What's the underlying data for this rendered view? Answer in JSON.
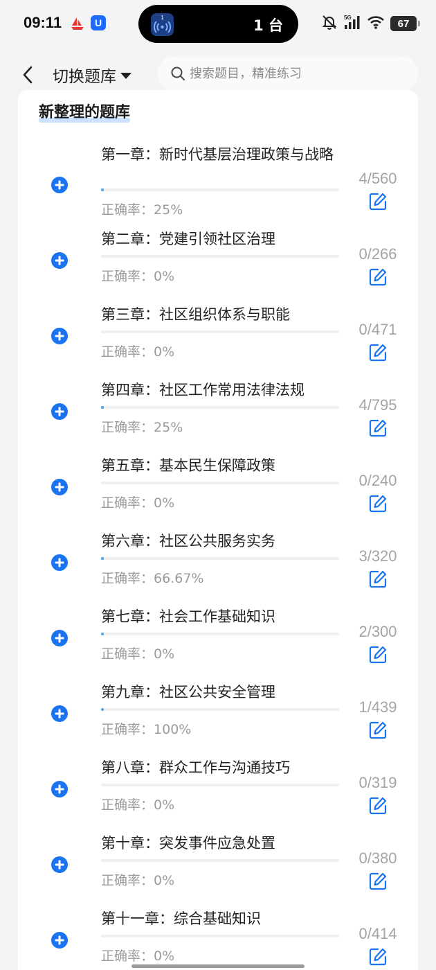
{
  "status_bar": {
    "time": "09:11",
    "island_count": "1 台",
    "network": "5G",
    "battery": "67"
  },
  "nav": {
    "switch_label": "切换题库",
    "search_placeholder": "搜索题目，精准练习"
  },
  "section": {
    "title": "新整理的题库"
  },
  "accuracy_prefix": "正确率：",
  "colors": {
    "accent": "#1a73f0",
    "progress": "#49a7f4",
    "muted_text": "#a4a4a4"
  },
  "chapters": [
    {
      "title": "第一章：新时代基层治理政策与战略",
      "done": 4,
      "total": 560,
      "count": "4/560",
      "accuracy": "25%"
    },
    {
      "title": "第二章：党建引领社区治理",
      "done": 0,
      "total": 266,
      "count": "0/266",
      "accuracy": "0%"
    },
    {
      "title": "第三章：社区组织体系与职能",
      "done": 0,
      "total": 471,
      "count": "0/471",
      "accuracy": "0%"
    },
    {
      "title": "第四章：社区工作常用法律法规",
      "done": 4,
      "total": 795,
      "count": "4/795",
      "accuracy": "25%"
    },
    {
      "title": "第五章：基本民生保障政策",
      "done": 0,
      "total": 240,
      "count": "0/240",
      "accuracy": "0%"
    },
    {
      "title": "第六章：社区公共服务实务",
      "done": 3,
      "total": 320,
      "count": "3/320",
      "accuracy": "66.67%"
    },
    {
      "title": "第七章：社会工作基础知识",
      "done": 2,
      "total": 300,
      "count": "2/300",
      "accuracy": "0%"
    },
    {
      "title": "第九章：社区公共安全管理",
      "done": 1,
      "total": 439,
      "count": "1/439",
      "accuracy": "100%"
    },
    {
      "title": "第八章：群众工作与沟通技巧",
      "done": 0,
      "total": 319,
      "count": "0/319",
      "accuracy": "0%"
    },
    {
      "title": "第十章：突发事件应急处置",
      "done": 0,
      "total": 380,
      "count": "0/380",
      "accuracy": "0%"
    },
    {
      "title": "第十一章：综合基础知识",
      "done": 0,
      "total": 414,
      "count": "0/414",
      "accuracy": "0%"
    }
  ]
}
